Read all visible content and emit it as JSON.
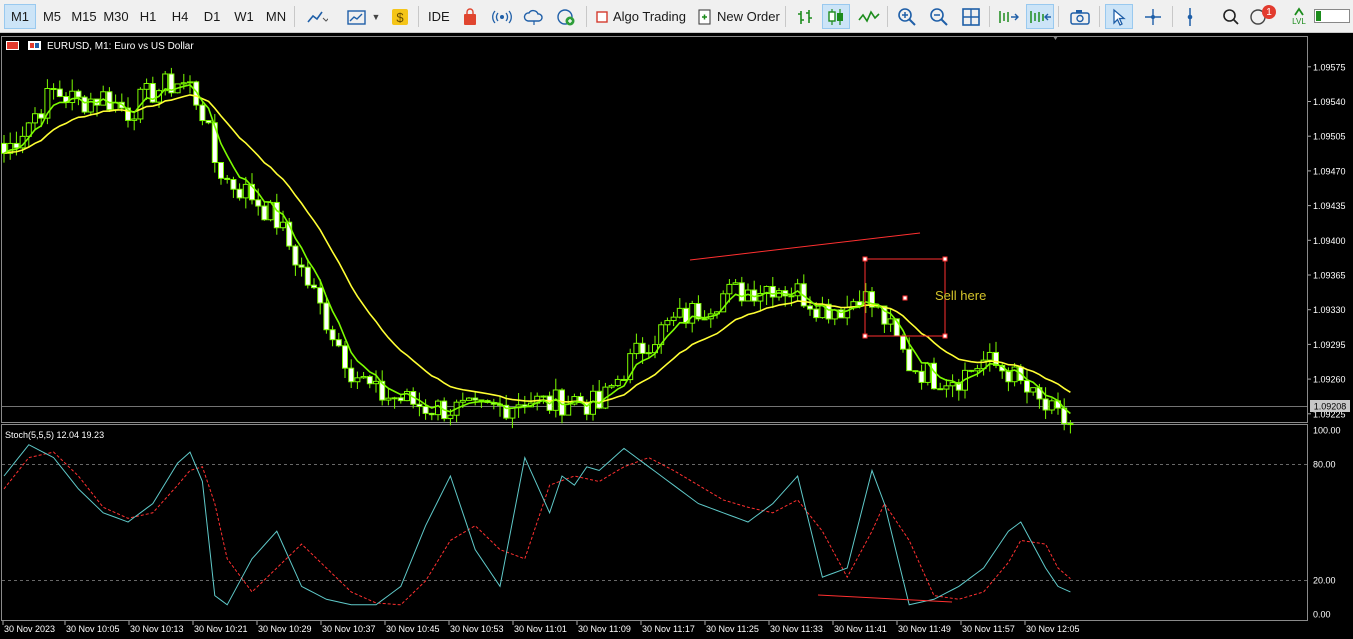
{
  "toolbar": {
    "timeframes": [
      "M1",
      "M5",
      "M15",
      "M30",
      "H1",
      "H4",
      "D1",
      "W1",
      "MN"
    ],
    "active_timeframe": "M1",
    "ide_label": "IDE",
    "algo_trading_label": "Algo Trading",
    "new_order_label": "New Order",
    "notification_count": "1",
    "lvl_label": "LVL",
    "icons": [
      "line-chart-icon",
      "chart-template-icon",
      "dollar-icon",
      "market-icon",
      "signals-icon",
      "cloud-icon",
      "vps-icon",
      "algo-stop-icon",
      "new-order-icon",
      "bar-chart-icon",
      "candlestick-icon",
      "line-icon",
      "zoom-in-icon",
      "zoom-out-icon",
      "grid-icon",
      "chart-shift-icon",
      "autoscroll-icon",
      "screenshot-icon",
      "cursor-icon",
      "crosshair-icon",
      "vertical-line-icon",
      "search-icon",
      "notifications-icon",
      "level-meter-icon"
    ]
  },
  "chart": {
    "symbol_title": "EURUSD, M1:  Euro vs US Dollar",
    "current_price": "1.09208",
    "price_ticks": [
      "1.09575",
      "1.09540",
      "1.09505",
      "1.09470",
      "1.09435",
      "1.09400",
      "1.09365",
      "1.09330",
      "1.09295",
      "1.09260",
      "1.09225"
    ],
    "annotation": "Sell here",
    "colors": {
      "background": "#000000",
      "candle": "#7cfc00",
      "fast_ma": "#7cfc00",
      "slow_ma": "#ffff33",
      "trendline": "#ff3030",
      "annotation": "#d4c32a"
    }
  },
  "indicator": {
    "title": "Stoch(5,5,5) 12.04 19.23",
    "ticks": [
      "100.00",
      "80.00",
      "20.00",
      "0.00"
    ],
    "colors": {
      "main": "#5fc9c9",
      "signal": "#ff3030"
    }
  },
  "time_axis": [
    "30 Nov 2023",
    "30 Nov 10:05",
    "30 Nov 10:13",
    "30 Nov 10:21",
    "30 Nov 10:29",
    "30 Nov 10:37",
    "30 Nov 10:45",
    "30 Nov 10:53",
    "30 Nov 11:01",
    "30 Nov 11:09",
    "30 Nov 11:17",
    "30 Nov 11:25",
    "30 Nov 11:33",
    "30 Nov 11:41",
    "30 Nov 11:49",
    "30 Nov 11:57",
    "30 Nov 12:05"
  ],
  "chart_data": {
    "type": "candlestick",
    "title": "EURUSD, M1:  Euro vs US Dollar",
    "y_range": [
      1.0921,
      1.0959
    ],
    "close_path": [
      [
        0,
        1.09488
      ],
      [
        4,
        1.0952
      ],
      [
        8,
        1.0955
      ],
      [
        12,
        1.0954
      ],
      [
        16,
        1.09545
      ],
      [
        20,
        1.0953
      ],
      [
        24,
        1.0955
      ],
      [
        28,
        1.0956
      ],
      [
        30,
        1.09555
      ],
      [
        32,
        1.0953
      ],
      [
        34,
        1.0948
      ],
      [
        36,
        1.0946
      ],
      [
        40,
        1.09445
      ],
      [
        44,
        1.0942
      ],
      [
        48,
        1.0937
      ],
      [
        52,
        1.0932
      ],
      [
        56,
        1.0927
      ],
      [
        60,
        1.09245
      ],
      [
        64,
        1.0924
      ],
      [
        68,
        1.09232
      ],
      [
        72,
        1.0923
      ],
      [
        76,
        1.09227
      ],
      [
        80,
        1.09232
      ],
      [
        84,
        1.0924
      ],
      [
        88,
        1.09235
      ],
      [
        92,
        1.0924
      ],
      [
        96,
        1.09232
      ],
      [
        100,
        1.0927
      ],
      [
        104,
        1.093
      ],
      [
        108,
        1.09318
      ],
      [
        112,
        1.0933
      ],
      [
        116,
        1.09345
      ],
      [
        120,
        1.0935
      ],
      [
        124,
        1.09355
      ],
      [
        128,
        1.09348
      ],
      [
        132,
        1.09332
      ],
      [
        136,
        1.09333
      ],
      [
        138,
        1.09348
      ],
      [
        142,
        1.0932
      ],
      [
        146,
        1.09275
      ],
      [
        150,
        1.09262
      ],
      [
        154,
        1.09262
      ],
      [
        158,
        1.09278
      ],
      [
        162,
        1.09268
      ],
      [
        166,
        1.0924
      ],
      [
        170,
        1.0922
      ],
      [
        172,
        1.09215
      ]
    ],
    "stochastic_main": [
      [
        0,
        75
      ],
      [
        4,
        92
      ],
      [
        8,
        85
      ],
      [
        12,
        68
      ],
      [
        16,
        55
      ],
      [
        20,
        50
      ],
      [
        24,
        60
      ],
      [
        28,
        82
      ],
      [
        30,
        88
      ],
      [
        32,
        72
      ],
      [
        34,
        10
      ],
      [
        36,
        5
      ],
      [
        40,
        30
      ],
      [
        44,
        45
      ],
      [
        48,
        15
      ],
      [
        52,
        8
      ],
      [
        56,
        5
      ],
      [
        60,
        5
      ],
      [
        64,
        15
      ],
      [
        68,
        48
      ],
      [
        72,
        75
      ],
      [
        76,
        35
      ],
      [
        80,
        15
      ],
      [
        84,
        85
      ],
      [
        88,
        55
      ],
      [
        90,
        75
      ],
      [
        92,
        70
      ],
      [
        94,
        80
      ],
      [
        96,
        78
      ],
      [
        100,
        90
      ],
      [
        104,
        80
      ],
      [
        108,
        70
      ],
      [
        112,
        60
      ],
      [
        116,
        55
      ],
      [
        120,
        50
      ],
      [
        124,
        60
      ],
      [
        128,
        75
      ],
      [
        132,
        20
      ],
      [
        136,
        25
      ],
      [
        140,
        78
      ],
      [
        142,
        60
      ],
      [
        146,
        5
      ],
      [
        150,
        8
      ],
      [
        154,
        15
      ],
      [
        158,
        25
      ],
      [
        162,
        45
      ],
      [
        164,
        50
      ],
      [
        168,
        25
      ],
      [
        170,
        15
      ],
      [
        172,
        12
      ]
    ],
    "stochastic_signal": [
      [
        0,
        68
      ],
      [
        4,
        85
      ],
      [
        8,
        88
      ],
      [
        12,
        75
      ],
      [
        16,
        58
      ],
      [
        20,
        52
      ],
      [
        24,
        55
      ],
      [
        28,
        70
      ],
      [
        30,
        78
      ],
      [
        32,
        80
      ],
      [
        34,
        60
      ],
      [
        36,
        30
      ],
      [
        40,
        12
      ],
      [
        44,
        25
      ],
      [
        48,
        38
      ],
      [
        52,
        25
      ],
      [
        56,
        12
      ],
      [
        60,
        6
      ],
      [
        64,
        5
      ],
      [
        68,
        18
      ],
      [
        72,
        40
      ],
      [
        76,
        48
      ],
      [
        80,
        35
      ],
      [
        84,
        30
      ],
      [
        88,
        70
      ],
      [
        92,
        75
      ],
      [
        96,
        72
      ],
      [
        100,
        80
      ],
      [
        104,
        85
      ],
      [
        108,
        78
      ],
      [
        112,
        70
      ],
      [
        116,
        62
      ],
      [
        120,
        58
      ],
      [
        124,
        55
      ],
      [
        128,
        62
      ],
      [
        132,
        45
      ],
      [
        136,
        20
      ],
      [
        140,
        45
      ],
      [
        142,
        60
      ],
      [
        146,
        40
      ],
      [
        150,
        10
      ],
      [
        154,
        8
      ],
      [
        158,
        12
      ],
      [
        162,
        28
      ],
      [
        164,
        40
      ],
      [
        168,
        38
      ],
      [
        170,
        25
      ],
      [
        172,
        19.23
      ]
    ]
  }
}
